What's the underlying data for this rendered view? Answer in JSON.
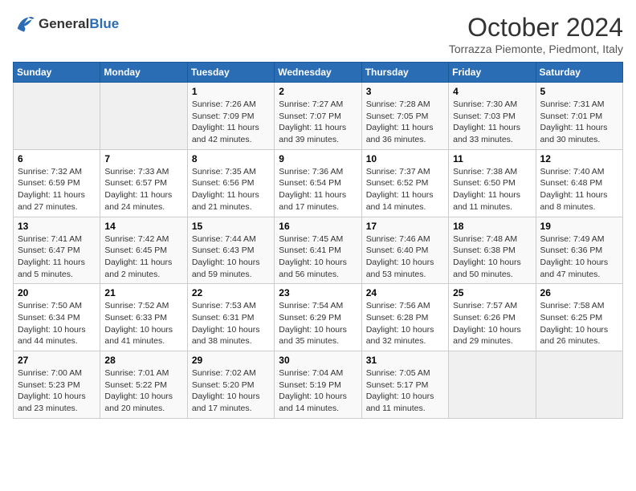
{
  "logo": {
    "line1": "General",
    "line2": "Blue"
  },
  "title": "October 2024",
  "location": "Torrazza Piemonte, Piedmont, Italy",
  "days_of_week": [
    "Sunday",
    "Monday",
    "Tuesday",
    "Wednesday",
    "Thursday",
    "Friday",
    "Saturday"
  ],
  "weeks": [
    [
      {
        "day": "",
        "info": ""
      },
      {
        "day": "",
        "info": ""
      },
      {
        "day": "1",
        "info": "Sunrise: 7:26 AM\nSunset: 7:09 PM\nDaylight: 11 hours and 42 minutes."
      },
      {
        "day": "2",
        "info": "Sunrise: 7:27 AM\nSunset: 7:07 PM\nDaylight: 11 hours and 39 minutes."
      },
      {
        "day": "3",
        "info": "Sunrise: 7:28 AM\nSunset: 7:05 PM\nDaylight: 11 hours and 36 minutes."
      },
      {
        "day": "4",
        "info": "Sunrise: 7:30 AM\nSunset: 7:03 PM\nDaylight: 11 hours and 33 minutes."
      },
      {
        "day": "5",
        "info": "Sunrise: 7:31 AM\nSunset: 7:01 PM\nDaylight: 11 hours and 30 minutes."
      }
    ],
    [
      {
        "day": "6",
        "info": "Sunrise: 7:32 AM\nSunset: 6:59 PM\nDaylight: 11 hours and 27 minutes."
      },
      {
        "day": "7",
        "info": "Sunrise: 7:33 AM\nSunset: 6:57 PM\nDaylight: 11 hours and 24 minutes."
      },
      {
        "day": "8",
        "info": "Sunrise: 7:35 AM\nSunset: 6:56 PM\nDaylight: 11 hours and 21 minutes."
      },
      {
        "day": "9",
        "info": "Sunrise: 7:36 AM\nSunset: 6:54 PM\nDaylight: 11 hours and 17 minutes."
      },
      {
        "day": "10",
        "info": "Sunrise: 7:37 AM\nSunset: 6:52 PM\nDaylight: 11 hours and 14 minutes."
      },
      {
        "day": "11",
        "info": "Sunrise: 7:38 AM\nSunset: 6:50 PM\nDaylight: 11 hours and 11 minutes."
      },
      {
        "day": "12",
        "info": "Sunrise: 7:40 AM\nSunset: 6:48 PM\nDaylight: 11 hours and 8 minutes."
      }
    ],
    [
      {
        "day": "13",
        "info": "Sunrise: 7:41 AM\nSunset: 6:47 PM\nDaylight: 11 hours and 5 minutes."
      },
      {
        "day": "14",
        "info": "Sunrise: 7:42 AM\nSunset: 6:45 PM\nDaylight: 11 hours and 2 minutes."
      },
      {
        "day": "15",
        "info": "Sunrise: 7:44 AM\nSunset: 6:43 PM\nDaylight: 10 hours and 59 minutes."
      },
      {
        "day": "16",
        "info": "Sunrise: 7:45 AM\nSunset: 6:41 PM\nDaylight: 10 hours and 56 minutes."
      },
      {
        "day": "17",
        "info": "Sunrise: 7:46 AM\nSunset: 6:40 PM\nDaylight: 10 hours and 53 minutes."
      },
      {
        "day": "18",
        "info": "Sunrise: 7:48 AM\nSunset: 6:38 PM\nDaylight: 10 hours and 50 minutes."
      },
      {
        "day": "19",
        "info": "Sunrise: 7:49 AM\nSunset: 6:36 PM\nDaylight: 10 hours and 47 minutes."
      }
    ],
    [
      {
        "day": "20",
        "info": "Sunrise: 7:50 AM\nSunset: 6:34 PM\nDaylight: 10 hours and 44 minutes."
      },
      {
        "day": "21",
        "info": "Sunrise: 7:52 AM\nSunset: 6:33 PM\nDaylight: 10 hours and 41 minutes."
      },
      {
        "day": "22",
        "info": "Sunrise: 7:53 AM\nSunset: 6:31 PM\nDaylight: 10 hours and 38 minutes."
      },
      {
        "day": "23",
        "info": "Sunrise: 7:54 AM\nSunset: 6:29 PM\nDaylight: 10 hours and 35 minutes."
      },
      {
        "day": "24",
        "info": "Sunrise: 7:56 AM\nSunset: 6:28 PM\nDaylight: 10 hours and 32 minutes."
      },
      {
        "day": "25",
        "info": "Sunrise: 7:57 AM\nSunset: 6:26 PM\nDaylight: 10 hours and 29 minutes."
      },
      {
        "day": "26",
        "info": "Sunrise: 7:58 AM\nSunset: 6:25 PM\nDaylight: 10 hours and 26 minutes."
      }
    ],
    [
      {
        "day": "27",
        "info": "Sunrise: 7:00 AM\nSunset: 5:23 PM\nDaylight: 10 hours and 23 minutes."
      },
      {
        "day": "28",
        "info": "Sunrise: 7:01 AM\nSunset: 5:22 PM\nDaylight: 10 hours and 20 minutes."
      },
      {
        "day": "29",
        "info": "Sunrise: 7:02 AM\nSunset: 5:20 PM\nDaylight: 10 hours and 17 minutes."
      },
      {
        "day": "30",
        "info": "Sunrise: 7:04 AM\nSunset: 5:19 PM\nDaylight: 10 hours and 14 minutes."
      },
      {
        "day": "31",
        "info": "Sunrise: 7:05 AM\nSunset: 5:17 PM\nDaylight: 10 hours and 11 minutes."
      },
      {
        "day": "",
        "info": ""
      },
      {
        "day": "",
        "info": ""
      }
    ]
  ]
}
